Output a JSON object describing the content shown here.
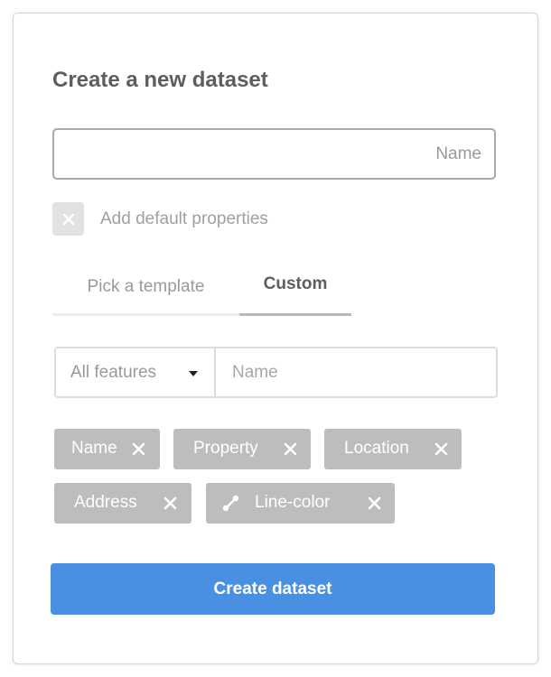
{
  "dialog": {
    "title": "Create a new dataset",
    "name_placeholder": "Name",
    "name_value": "",
    "default_properties": {
      "label": "Add default properties",
      "checked": false
    },
    "tabs": [
      {
        "label": "Pick a template",
        "active": false
      },
      {
        "label": "Custom",
        "active": true
      }
    ],
    "filter": {
      "selected": "All features",
      "property_placeholder": "Name"
    },
    "tags": [
      {
        "label": "Name",
        "icon": null
      },
      {
        "label": "Property",
        "icon": null
      },
      {
        "label": "Location",
        "icon": null
      },
      {
        "label": "Address",
        "icon": null
      },
      {
        "label": "Line-color",
        "icon": "line-segment-icon"
      }
    ],
    "submit_label": "Create dataset"
  },
  "colors": {
    "accent": "#4a90e2",
    "tag_background": "#bdbdbd",
    "title": "#5e5e5e",
    "muted_text": "#9a9a9a"
  }
}
